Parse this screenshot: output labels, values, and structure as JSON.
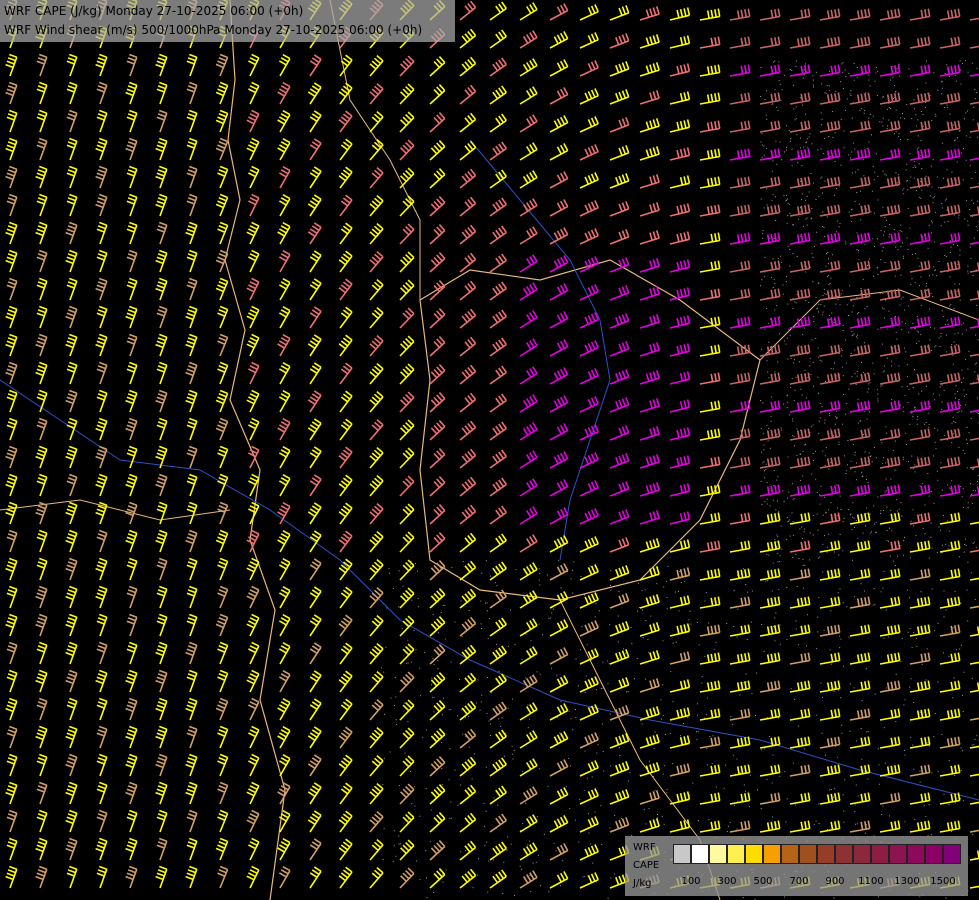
{
  "header": {
    "line1": "WRF CAPE (J/kg) Monday 27-10-2025 06:00 (+0h)",
    "line2": "WRF Wind shear (m/s) 500/1000hPa Monday 27-10-2025 06:00 (+0h)"
  },
  "legend": {
    "row1": "WRF",
    "row2": "CAPE",
    "row3": "J/kg",
    "colors": [
      "#c8c8c8",
      "#ffffff",
      "#fffaa0",
      "#fff050",
      "#ffdc00",
      "#f5a000",
      "#b46414",
      "#a0501e",
      "#963c28",
      "#8c3232",
      "#8c283c",
      "#8c1e46",
      "#8c1450",
      "#8c0a5a",
      "#8c0064",
      "#820078"
    ],
    "tick_labels": [
      "100",
      "300",
      "500",
      "700",
      "900",
      "1100",
      "1300",
      "1500"
    ]
  },
  "map_colors": {
    "yellow": "#ffff00",
    "tan": "#d2a064",
    "salmon": "#f07070",
    "rose": "#c86464",
    "magenta": "#e600e6",
    "border": "#e8b878",
    "river": "#3050c8"
  }
}
